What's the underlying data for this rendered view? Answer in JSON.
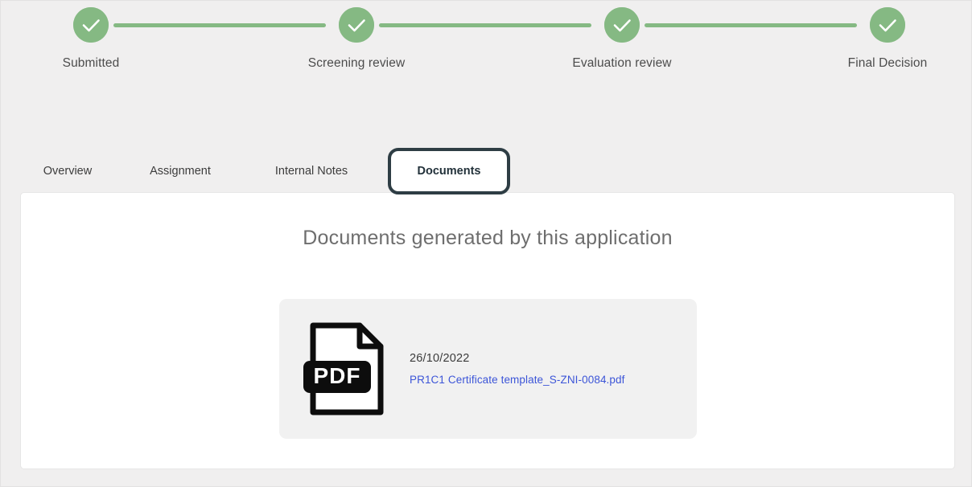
{
  "stepper": {
    "steps": [
      {
        "label": "Submitted",
        "state": "complete",
        "icon": "check-circle-icon"
      },
      {
        "label": "Screening review",
        "state": "complete",
        "icon": "check-circle-icon"
      },
      {
        "label": "Evaluation review",
        "state": "complete",
        "icon": "check-circle-icon"
      },
      {
        "label": "Final Decision",
        "state": "complete",
        "icon": "check-circle-icon"
      }
    ],
    "accent_color": "#85b983"
  },
  "tabs": {
    "items": [
      {
        "label": "Overview",
        "active": false
      },
      {
        "label": "Assignment",
        "active": false
      },
      {
        "label": "Internal Notes",
        "active": false
      },
      {
        "label": "Documents",
        "active": true
      }
    ],
    "active_border_color": "#2e3d44"
  },
  "panel": {
    "title": "Documents generated by this application",
    "documents": [
      {
        "date": "26/10/2022",
        "filename": "PR1C1 Certificate template_S-ZNI-0084.pdf",
        "icon": "pdf-file-icon",
        "badge": "PDF",
        "link_color": "#3c55d8"
      }
    ]
  }
}
